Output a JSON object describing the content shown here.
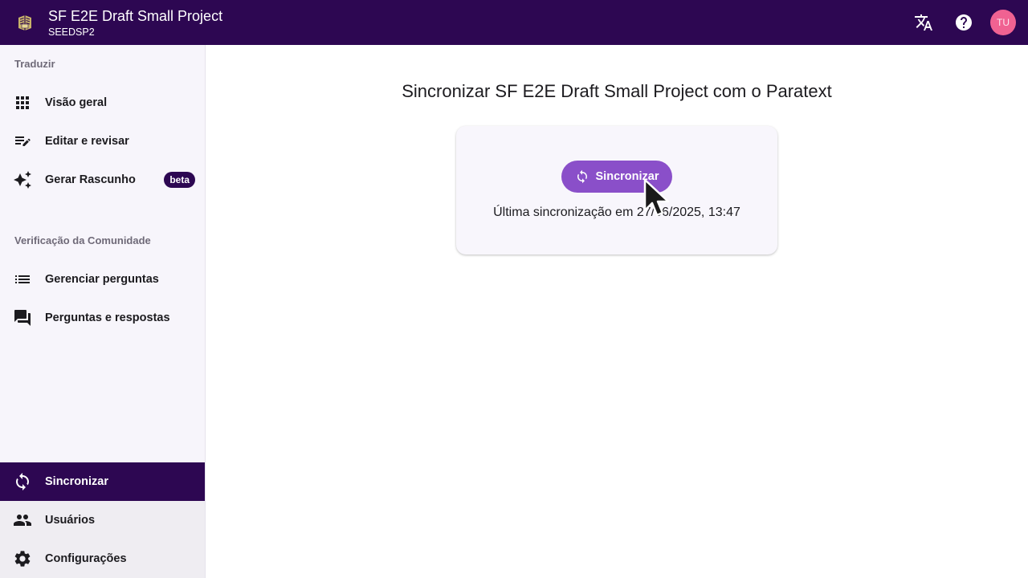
{
  "header": {
    "project_name": "SF E2E Draft Small Project",
    "project_code": "SEEDSP2",
    "avatar_initials": "TU"
  },
  "sidebar": {
    "translate_section": "Traduzir",
    "community_section": "Verificação da Comunidade",
    "items": [
      {
        "label": "Visão geral",
        "icon": "grid-icon"
      },
      {
        "label": "Editar e revisar",
        "icon": "edit-list-icon"
      },
      {
        "label": "Gerar Rascunho",
        "icon": "sparkle-icon",
        "badge": "beta"
      },
      {
        "label": "Gerenciar perguntas",
        "icon": "list-icon"
      },
      {
        "label": "Perguntas e respostas",
        "icon": "chat-icon"
      },
      {
        "label": "Sincronizar",
        "icon": "sync-icon",
        "active": true
      },
      {
        "label": "Usuários",
        "icon": "people-icon"
      },
      {
        "label": "Configurações",
        "icon": "gear-icon"
      }
    ]
  },
  "main": {
    "title": "Sincronizar SF E2E Draft Small Project com o Paratext",
    "sync_button": "Sincronizar",
    "last_sync": "Última sincronização em 27/06/2025, 13:47"
  },
  "colors": {
    "primary": "#2d0752",
    "accent_button": "#8a4fc9",
    "avatar": "#f06292"
  }
}
